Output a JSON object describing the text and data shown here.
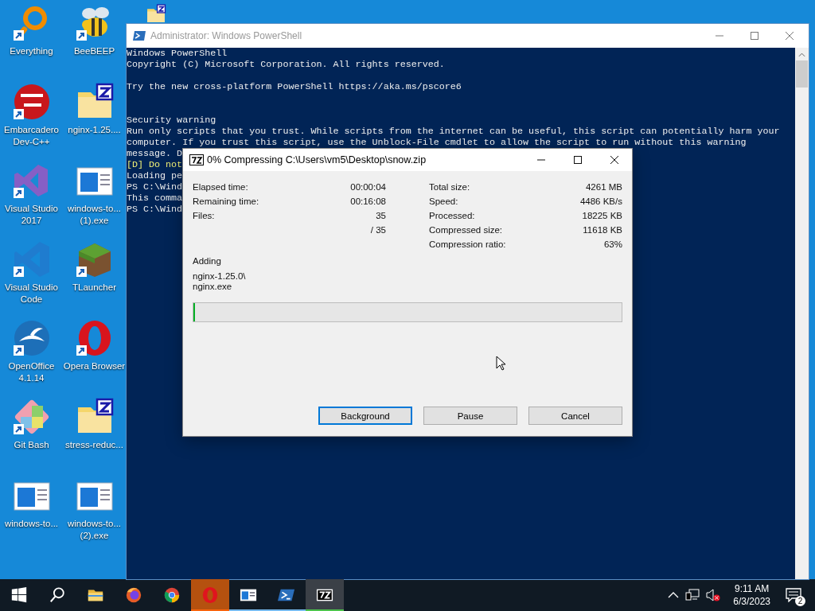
{
  "desktop": {
    "icons": [
      {
        "label": "Everything",
        "kind": "search-ring",
        "shortcut": true
      },
      {
        "label": "BeeBEEP",
        "kind": "bee",
        "shortcut": true
      },
      {
        "kind": "zip-folder-7z",
        "shortcut": false
      },
      {
        "label": "Embarcadero Dev-C++",
        "kind": "devcpp",
        "shortcut": true
      },
      {
        "label": "nginx-1.25....",
        "kind": "zip-folder",
        "shortcut": false
      },
      {
        "label": "Visual Studio 2017",
        "kind": "vs2017",
        "shortcut": true
      },
      {
        "label": "windows-to... (1).exe",
        "kind": "installer",
        "shortcut": false
      },
      {
        "label": "Visual Studio Code",
        "kind": "vscode",
        "shortcut": true
      },
      {
        "label": "TLauncher",
        "kind": "grass-block",
        "shortcut": true
      },
      {
        "label": "OpenOffice 4.1.14",
        "kind": "openoffice",
        "shortcut": true
      },
      {
        "label": "Opera Browser",
        "kind": "opera",
        "shortcut": true
      },
      {
        "label": "Git Bash",
        "kind": "gitbash",
        "shortcut": true
      },
      {
        "label": "stress-reduc...",
        "kind": "zip-folder",
        "shortcut": false
      },
      {
        "label": "windows-to...",
        "kind": "installer",
        "shortcut": false
      },
      {
        "label": "windows-to... (2).exe",
        "kind": "installer",
        "shortcut": false
      }
    ]
  },
  "powershell_window": {
    "title": "Administrator: Windows PowerShell",
    "active": false,
    "console_lines": [
      {
        "kind": "text",
        "text": "Windows PowerShell",
        "highlight": false
      },
      {
        "kind": "text",
        "text": "Copyright (C) Microsoft Corporation. All rights reserved.",
        "highlight": false
      },
      {
        "kind": "blank"
      },
      {
        "kind": "text",
        "text": "Try the new cross-platform PowerShell https://aka.ms/pscore6",
        "highlight": false
      },
      {
        "kind": "blank"
      },
      {
        "kind": "blank"
      },
      {
        "kind": "text",
        "text": "Security warning",
        "highlight": false
      },
      {
        "kind": "text",
        "text": "Run only scripts that you trust. While scripts from the internet can be useful, this script can potentially harm your",
        "highlight": false
      },
      {
        "kind": "text",
        "text": "computer. If you trust this script, use the Unblock-File cmdlet to allow the script to run without this warning",
        "highlight": false
      },
      {
        "kind": "text",
        "text": "message. D",
        "highlight": false
      },
      {
        "kind": "text",
        "text": "[D] Do not",
        "highlight": true
      },
      {
        "kind": "text",
        "text": "Loading pe",
        "highlight": false
      },
      {
        "kind": "text",
        "text": "PS C:\\Wind",
        "highlight": false
      },
      {
        "kind": "text",
        "text": "This comma",
        "highlight": false
      },
      {
        "kind": "text",
        "text": "PS C:\\Wind",
        "highlight": false
      }
    ]
  },
  "dialog": {
    "title": "0% Compressing C:\\Users\\vm5\\Desktop\\snow.zip",
    "stats_left": [
      {
        "label": "Elapsed time:",
        "value": "00:00:04"
      },
      {
        "label": "Remaining time:",
        "value": "00:16:08"
      },
      {
        "label": "Files:",
        "value": "35"
      },
      {
        "value": "/ 35"
      }
    ],
    "stats_right": [
      {
        "label": "Total size:",
        "value": "4261 MB"
      },
      {
        "label": "Speed:",
        "value": "4486 KB/s"
      },
      {
        "label": "Processed:",
        "value": "18225 KB"
      },
      {
        "label": "Compressed size:",
        "value": "11618 KB"
      },
      {
        "label": "Compression ratio:",
        "value": "63%"
      }
    ],
    "status": "Adding",
    "current_file": [
      "nginx-1.25.0\\",
      "nginx.exe"
    ],
    "progress": {
      "level": 0.004
    },
    "buttons": [
      {
        "label": "Background",
        "focused": true
      },
      {
        "label": "Pause",
        "focused": false
      },
      {
        "label": "Cancel",
        "focused": false
      }
    ]
  },
  "taskbar": {
    "apps": [
      {
        "kind": "start",
        "running": false,
        "active": false,
        "flashing": false
      },
      {
        "kind": "search",
        "running": false,
        "active": false,
        "flashing": false
      },
      {
        "kind": "explorer",
        "running": false,
        "active": false,
        "flashing": false
      },
      {
        "kind": "firefox",
        "running": false,
        "active": false,
        "flashing": false
      },
      {
        "kind": "chrome",
        "running": false,
        "active": false,
        "flashing": false
      },
      {
        "kind": "opera",
        "running": true,
        "active": false,
        "flashing": true
      },
      {
        "kind": "window-app",
        "running": true,
        "active": false,
        "flashing": false
      },
      {
        "kind": "powershell",
        "running": true,
        "active": false,
        "flashing": false
      },
      {
        "kind": "sevenzip",
        "running": true,
        "active": true,
        "flashing": false
      }
    ],
    "clock": {
      "time": "9:11 AM",
      "date": "6/3/2023"
    },
    "notification_count": "2"
  }
}
